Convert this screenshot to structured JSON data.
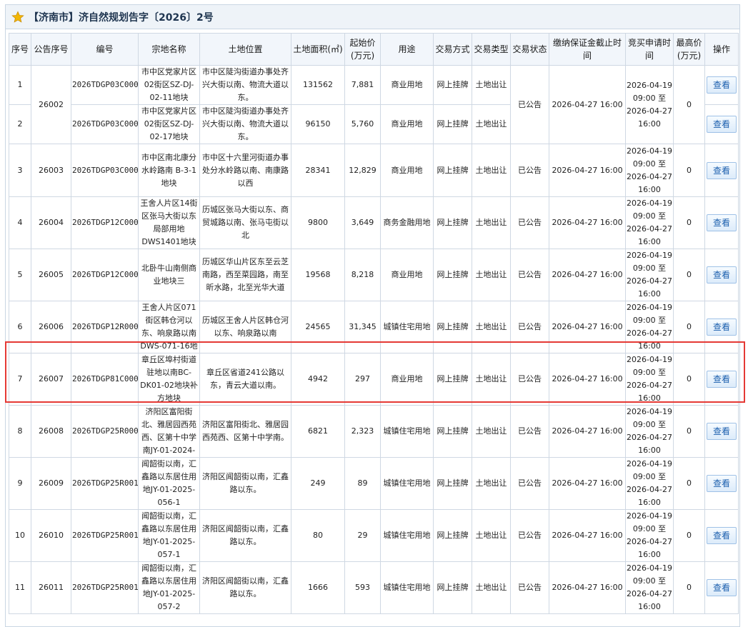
{
  "header": {
    "title": "【济南市】济自然规划告字〔2026〕2号"
  },
  "columns": [
    "序号",
    "公告序号",
    "编号",
    "宗地名称",
    "土地位置",
    "土地面积(㎡)",
    "起始价(万元)",
    "用途",
    "交易方式",
    "交易类型",
    "交易状态",
    "缴纳保证金截止时间",
    "竞买申请时间",
    "最高价(万元)",
    "操作"
  ],
  "rows": [
    {
      "no": "1",
      "notice": "26002",
      "code": "2026TDGP03C0002",
      "name": "市中区党家片区02街区SZ-DJ-02-11地块",
      "loc": "市中区陡沟街道办事处齐兴大街以南、物流大道以东。",
      "area": "131562",
      "price": "7,881",
      "use": "商业用地",
      "method": "网上挂牌",
      "type": "土地出让",
      "status": "已公告",
      "deadline": "2026-04-27 16:00",
      "apply": "2026-04-19 09:00 至 2026-04-27 16:00",
      "max": "0",
      "action": "查看"
    },
    {
      "no": "2",
      "notice": "",
      "code": "2026TDGP03C0003",
      "name": "市中区党家片区02街区SZ-DJ-02-17地块",
      "loc": "市中区陡沟街道办事处齐兴大街以南、物流大道以东。",
      "area": "96150",
      "price": "5,760",
      "use": "商业用地",
      "method": "网上挂牌",
      "type": "土地出让",
      "status": "",
      "deadline": "",
      "apply": "2026-04-27 16:00",
      "max": "",
      "action": "查看"
    },
    {
      "no": "3",
      "notice": "26003",
      "code": "2026TDGP03C0004",
      "name": "市中区南北康分水岭路南 B-3-1地块",
      "loc": "市中区十六里河街道办事处分水岭路以南、南康路以西",
      "area": "28341",
      "price": "12,829",
      "use": "商业用地",
      "method": "网上挂牌",
      "type": "土地出让",
      "status": "已公告",
      "deadline": "2026-04-27 16:00",
      "apply": "2026-04-19 09:00 至 2026-04-27 16:00",
      "max": "0",
      "action": "查看"
    },
    {
      "no": "4",
      "notice": "26004",
      "code": "2026TDGP12C0005",
      "name": "王舍人片区14街区张马大街以东局部用地DWS1401地块",
      "loc": "历城区张马大街以东、商贸城路以南、张马屯街以北",
      "area": "9800",
      "price": "3,649",
      "use": "商务金融用地",
      "method": "网上挂牌",
      "type": "土地出让",
      "status": "已公告",
      "deadline": "2026-04-27 16:00",
      "apply": "2026-04-19 09:00 至 2026-04-27 16:00",
      "max": "0",
      "action": "查看"
    },
    {
      "no": "5",
      "notice": "26005",
      "code": "2026TDGP12C0006",
      "name": "北卧牛山南侧商业地块三",
      "loc": "历城区华山片区东至云芝南路，西至菜园路，南至昕水路，北至光华大道",
      "area": "19568",
      "price": "8,218",
      "use": "商业用地",
      "method": "网上挂牌",
      "type": "土地出让",
      "status": "已公告",
      "deadline": "2026-04-27 16:00",
      "apply": "2026-04-19 09:00 至 2026-04-27 16:00",
      "max": "0",
      "action": "查看"
    },
    {
      "no": "6",
      "notice": "26006",
      "code": "2026TDGP12R0007",
      "name": "王舍人片区071街区韩仓河以东、响泉路以南DWS-071-16地块",
      "loc": "历城区王舍人片区韩仓河以东、响泉路以南",
      "area": "24565",
      "price": "31,345",
      "use": "城镇住宅用地",
      "method": "网上挂牌",
      "type": "土地出让",
      "status": "已公告",
      "deadline": "2026-04-27 16:00",
      "apply": "2026-04-19 09:00 至 2026-04-27 16:00",
      "max": "0",
      "action": "查看"
    },
    {
      "no": "7",
      "notice": "26007",
      "code": "2026TDGP81C0008",
      "name": "章丘区埠村街道驻地以南BC-DK01-02地块补方地块",
      "loc": "章丘区省道241公路以东，青云大道以南。",
      "area": "4942",
      "price": "297",
      "use": "商业用地",
      "method": "网上挂牌",
      "type": "土地出让",
      "status": "已公告",
      "deadline": "2026-04-27 16:00",
      "apply": "2026-04-19 09:00 至 2026-04-27 16:00",
      "max": "0",
      "action": "查看"
    },
    {
      "no": "8",
      "notice": "26008",
      "code": "2026TDGP25R0009",
      "name": "济阳区富阳街北、雅居园西苑西、区第十中学南JY-01-2024-032-1",
      "loc": "济阳区富阳街北、雅居园西苑西、区第十中学南。",
      "area": "6821",
      "price": "2,323",
      "use": "城镇住宅用地",
      "method": "网上挂牌",
      "type": "土地出让",
      "status": "已公告",
      "deadline": "2026-04-27 16:00",
      "apply": "2026-04-19 09:00 至 2026-04-27 16:00",
      "max": "0",
      "action": "查看"
    },
    {
      "no": "9",
      "notice": "26009",
      "code": "2026TDGP25R0010",
      "name": "闻韶街以南，汇鑫路以东居住用地JY-01-2025-056-1",
      "loc": "济阳区闻韶街以南，汇鑫路以东。",
      "area": "249",
      "price": "89",
      "use": "城镇住宅用地",
      "method": "网上挂牌",
      "type": "土地出让",
      "status": "已公告",
      "deadline": "2026-04-27 16:00",
      "apply": "2026-04-19 09:00 至 2026-04-27 16:00",
      "max": "0",
      "action": "查看"
    },
    {
      "no": "10",
      "notice": "26010",
      "code": "2026TDGP25R0011",
      "name": "闻韶街以南，汇鑫路以东居住用地JY-01-2025-057-1",
      "loc": "济阳区闻韶街以南，汇鑫路以东。",
      "area": "80",
      "price": "29",
      "use": "城镇住宅用地",
      "method": "网上挂牌",
      "type": "土地出让",
      "status": "已公告",
      "deadline": "2026-04-27 16:00",
      "apply": "2026-04-19 09:00 至 2026-04-27 16:00",
      "max": "0",
      "action": "查看"
    },
    {
      "no": "11",
      "notice": "26011",
      "code": "2026TDGP25R0012",
      "name": "闻韶街以南，汇鑫路以东居住用地JY-01-2025-057-2",
      "loc": "济阳区闻韶街以南，汇鑫路以东。",
      "area": "1666",
      "price": "593",
      "use": "城镇住宅用地",
      "method": "网上挂牌",
      "type": "土地出让",
      "status": "已公告",
      "deadline": "2026-04-27 16:00",
      "apply": "2026-04-19 09:00 至 2026-04-27 16:00",
      "max": "0",
      "action": "查看"
    }
  ]
}
